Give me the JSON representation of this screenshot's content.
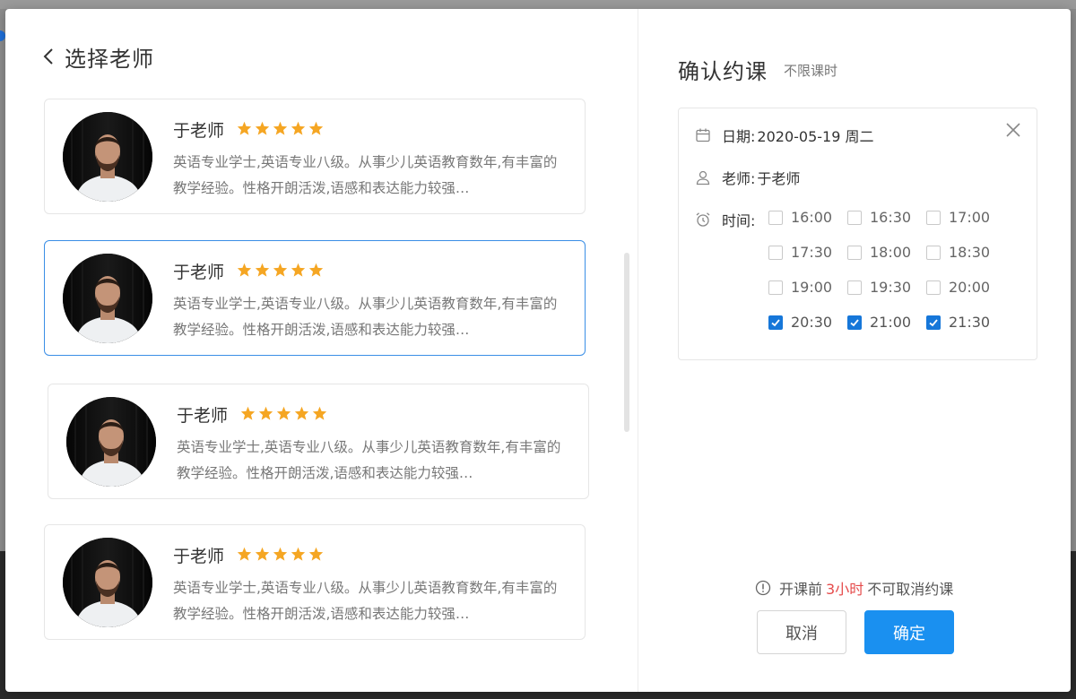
{
  "left": {
    "title": "选择老师",
    "teachers": [
      {
        "name": "于老师",
        "rating": 5,
        "desc": "英语专业学士,英语专业八级。从事少儿英语教育数年,有丰富的教学经验。性格开朗活泼,语感和表达能力较强…",
        "selected": false
      },
      {
        "name": "于老师",
        "rating": 5,
        "desc": "英语专业学士,英语专业八级。从事少儿英语教育数年,有丰富的教学经验。性格开朗活泼,语感和表达能力较强…",
        "selected": true
      },
      {
        "name": "于老师",
        "rating": 5,
        "desc": "英语专业学士,英语专业八级。从事少儿英语教育数年,有丰富的教学经验。性格开朗活泼,语感和表达能力较强…",
        "selected": false
      },
      {
        "name": "于老师",
        "rating": 5,
        "desc": "英语专业学士,英语专业八级。从事少儿英语教育数年,有丰富的教学经验。性格开朗活泼,语感和表达能力较强…",
        "selected": false
      }
    ]
  },
  "right": {
    "title": "确认约课",
    "subtitle": "不限课时",
    "date_label": "日期:",
    "date_value": "2020-05-19 周二",
    "teacher_label": "老师:",
    "teacher_value": "于老师",
    "time_label": "时间:",
    "times": [
      {
        "label": "16:00",
        "checked": false
      },
      {
        "label": "16:30",
        "checked": false
      },
      {
        "label": "17:00",
        "checked": false
      },
      {
        "label": "17:30",
        "checked": false
      },
      {
        "label": "18:00",
        "checked": false
      },
      {
        "label": "18:30",
        "checked": false
      },
      {
        "label": "19:00",
        "checked": false
      },
      {
        "label": "19:30",
        "checked": false
      },
      {
        "label": "20:00",
        "checked": false
      },
      {
        "label": "20:30",
        "checked": true
      },
      {
        "label": "21:00",
        "checked": true
      },
      {
        "label": "21:30",
        "checked": true
      }
    ],
    "notice_prefix": "开课前",
    "notice_highlight": "3小时",
    "notice_suffix": "不可取消约课",
    "cancel_label": "取消",
    "ok_label": "确定"
  },
  "colors": {
    "accent": "#1a90f0",
    "selected_border": "#3a8ee6",
    "star": "#f5a623",
    "highlight": "#e54b4b"
  },
  "icons": {
    "back": "chevron-left-icon",
    "star": "star-icon",
    "close": "close-icon",
    "calendar": "calendar-icon",
    "user": "user-icon",
    "clock": "alarm-clock-icon",
    "notice": "info-circle-icon"
  }
}
